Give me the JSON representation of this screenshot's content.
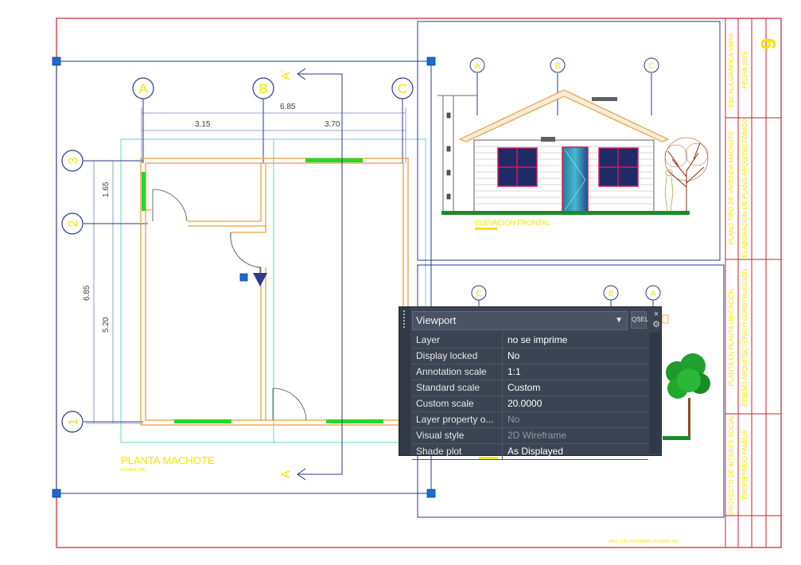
{
  "drawing": {
    "plan": {
      "grid_columns": [
        "A",
        "B",
        "C"
      ],
      "grid_rows": [
        "3",
        "2",
        "1"
      ],
      "dim_total": "6.85",
      "dim_left": "3.15",
      "dim_right": "3.70",
      "dim_vert_top": "1.65",
      "dim_vert_bottom": "5.20",
      "dim_vert_total": "6.85",
      "section_top": "A´",
      "section_bottom": "A",
      "title": "PLANTA MACHOTE",
      "scale_note": "ESCALA 1/50"
    },
    "elevation": {
      "grid_columns": [
        "A",
        "B",
        "C"
      ],
      "title": "ELEVACION FRONTAL"
    },
    "lower_view": {
      "grid_columns": [
        "C",
        "B",
        "A"
      ]
    },
    "title_block": {
      "sheet_number": "9",
      "col1_top": "ESCALA GRÁFICA\nVARIA",
      "col1_mid": "PLANO TIPO\nDE VIVIENDA MACHOTE",
      "col1_low": "PLANTA EN PLANTA\nUBICACIÓN",
      "col1_bottom": "PROYECTO DE INTERÉS\nSOCIAL",
      "col2_top": "FECHA\n2023",
      "col2_mid": "ELABORACIÓN DE PLANO\nARQUITECTÓNICO",
      "col2_low": "DISEÑO ARQUITECTÓNICO\nCONSTRUCCIÓN",
      "col2_bottom": "PROPIETARIO\nFAMILIA",
      "footer": "ARQ. LUIS FERNANDO ROMERO PAZ"
    },
    "colors": {
      "border": "#d21e2e",
      "viewport": "#2d3a8c",
      "text": "#f2e600",
      "wall": "#e8a040",
      "window": "#22d92a",
      "hatch": "#5bd6d6",
      "roof": "#e8a040",
      "grip": "#1a6ad6"
    }
  },
  "properties_panel": {
    "object_type": "Viewport",
    "quick_select_label": "QSEL",
    "close_icon": "×",
    "rows": [
      {
        "key": "Layer",
        "value": "no se imprime",
        "disabled": false
      },
      {
        "key": "Display locked",
        "value": "No",
        "disabled": false
      },
      {
        "key": "Annotation scale",
        "value": "1:1",
        "disabled": false
      },
      {
        "key": "Standard scale",
        "value": "Custom",
        "disabled": false
      },
      {
        "key": "Custom scale",
        "value": "20.0000",
        "disabled": false
      },
      {
        "key": "Layer property o...",
        "value": "No",
        "disabled": true
      },
      {
        "key": "Visual style",
        "value": "2D Wireframe",
        "disabled": true
      },
      {
        "key": "Shade plot",
        "value": "As Displayed",
        "disabled": false
      }
    ]
  }
}
